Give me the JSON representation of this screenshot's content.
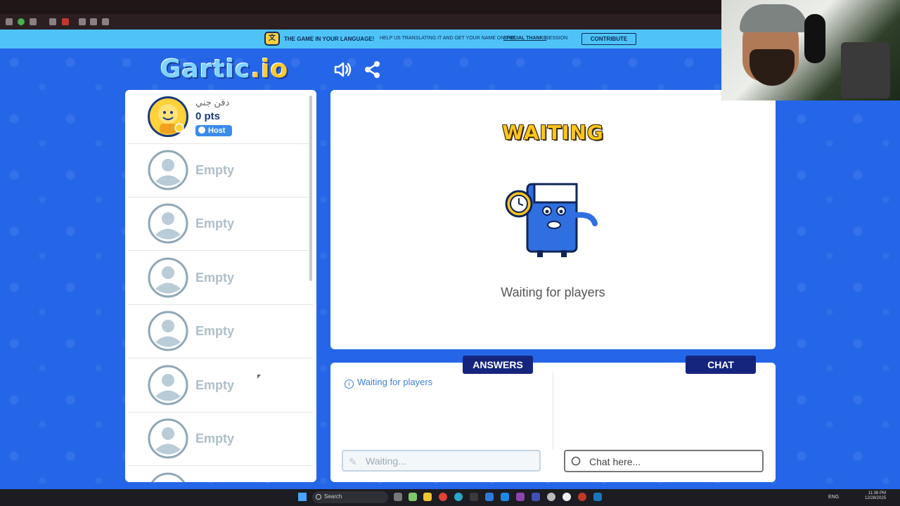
{
  "banner": {
    "highlight": "THE GAME IN YOUR LANGUAGE!",
    "text": "HELP US TRANSLATING IT AND GET YOUR NAME ON THE",
    "link": "SPECIAL THANKS",
    "suffix": "SESSION",
    "contribute_label": "CONTRIBUTE"
  },
  "header": {
    "logo_main": "Gartic",
    "logo_suffix": ".io",
    "sound_icon": "speaker-icon",
    "share_icon": "share-icon"
  },
  "players": {
    "host": {
      "name": "دقن جني",
      "points": "0 pts",
      "badge": "Host"
    },
    "empty_slots": [
      "Empty",
      "Empty",
      "Empty",
      "Empty",
      "Empty",
      "Empty"
    ]
  },
  "main": {
    "title": "WAITING",
    "subtitle": "Waiting for players"
  },
  "answers": {
    "tab_label": "ANSWERS",
    "status": "Waiting for players",
    "input_placeholder": "Waiting..."
  },
  "chat": {
    "tab_label": "CHAT",
    "input_placeholder": "Chat here..."
  },
  "taskbar": {
    "search_label": "Search",
    "language": "ENG",
    "time": "11:36 PM",
    "date": "12/28/2025"
  },
  "colors": {
    "background": "#2566e8",
    "banner": "#4fc3f7",
    "tab": "#15257e",
    "title_yellow": "#ffc61a"
  }
}
